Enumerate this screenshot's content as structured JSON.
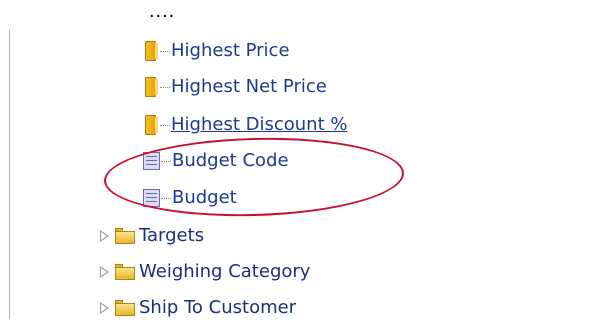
{
  "top_ellipsis": "....",
  "measures": [
    {
      "label": "Highest Price",
      "icon": "measure-icon"
    },
    {
      "label": "Highest Net Price",
      "icon": "measure-icon"
    },
    {
      "label": "Highest Discount %",
      "icon": "measure-icon"
    }
  ],
  "attributes": [
    {
      "label": "Budget Code",
      "icon": "attribute-icon"
    },
    {
      "label": "Budget",
      "icon": "attribute-icon"
    }
  ],
  "folders": [
    {
      "label": "Targets",
      "icon": "folder-icon"
    },
    {
      "label": "Weighing Category",
      "icon": "folder-icon"
    },
    {
      "label": "Ship To Customer",
      "icon": "folder-icon"
    }
  ],
  "highlight_color": "#c8102e"
}
